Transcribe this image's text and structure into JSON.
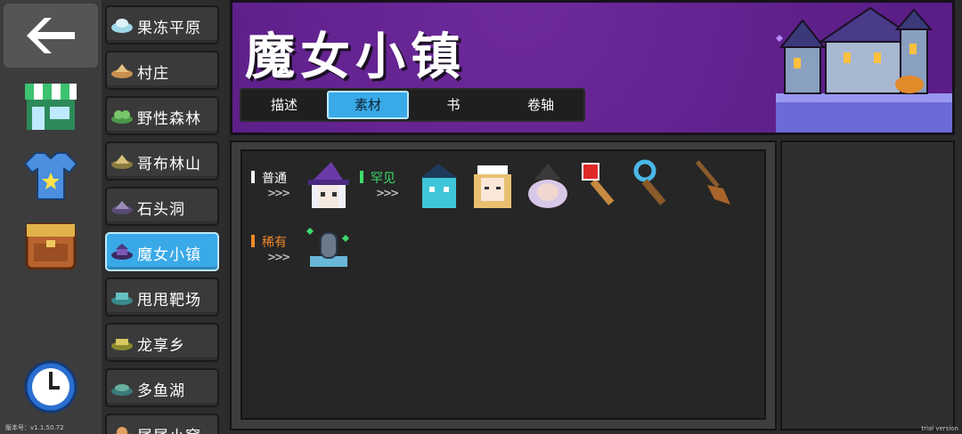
{
  "version_label": "版本号：v1.1.50.72",
  "watermark": "trial version",
  "regions": [
    {
      "label": "果冻平原",
      "icon": "jelly-plain-icon",
      "color": "#9fd8e8"
    },
    {
      "label": "村庄",
      "icon": "village-icon",
      "color": "#e8c080"
    },
    {
      "label": "野性森林",
      "icon": "wild-forest-icon",
      "color": "#7ac66a"
    },
    {
      "label": "哥布林山",
      "icon": "goblin-mountain-icon",
      "color": "#d6c07a"
    },
    {
      "label": "石头洞",
      "icon": "stone-cave-icon",
      "color": "#9a8ab8"
    },
    {
      "label": "魔女小镇",
      "icon": "witch-town-icon",
      "color": "#7a58b8"
    },
    {
      "label": "甩甩靶场",
      "icon": "target-range-icon",
      "color": "#66c0c0"
    },
    {
      "label": "龙享乡",
      "icon": "dragon-village-icon",
      "color": "#d8c860"
    },
    {
      "label": "多鱼湖",
      "icon": "fish-lake-icon",
      "color": "#6ab0a0"
    },
    {
      "label": "尾尾小窝",
      "icon": "tail-nest-icon",
      "color": "#e0a060"
    }
  ],
  "selected_region": "魔女小镇",
  "header": {
    "title": "魔女小镇",
    "tabs": [
      "描述",
      "素材",
      "书",
      "卷轴"
    ],
    "active_tab": "素材"
  },
  "rarities": [
    {
      "name": "普通",
      "color": "#ffffff",
      "arrows": ">>>",
      "items": [
        "witch-girl-icon"
      ]
    },
    {
      "name": "罕见",
      "color": "#3ddc6a",
      "arrows": ">>>",
      "items": [
        "ghost-witch-icon",
        "maid-girl-icon",
        "old-witch-icon",
        "red-wand-icon",
        "blue-staff-icon",
        "broom-icon"
      ]
    },
    {
      "name": "稀有",
      "color": "#f0882a",
      "arrows": ">>>",
      "items": [
        "tombstone-icon"
      ]
    }
  ],
  "colors": {
    "accent": "#3aa9e8",
    "header_bg": "#5b1d86"
  }
}
